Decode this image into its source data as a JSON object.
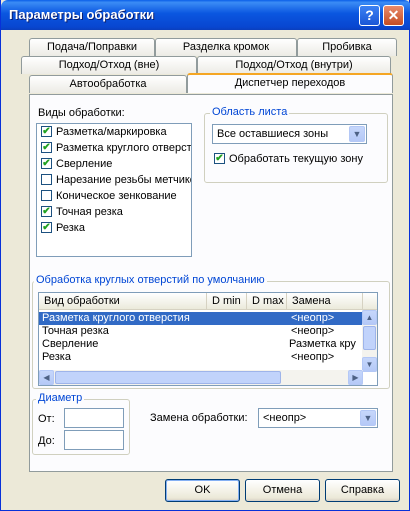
{
  "window": {
    "title": "Параметры обработки"
  },
  "titlebar": {
    "help_icon": "?",
    "close_icon": "✕"
  },
  "tabs": {
    "row1": [
      "Подача/Поправки",
      "Разделка кромок",
      "Пробивка"
    ],
    "row2": [
      "Подход/Отход (вне)",
      "Подход/Отход (внутри)"
    ],
    "row3": [
      "Автообработка",
      "Диспетчер переходов"
    ],
    "active": "Диспетчер переходов"
  },
  "processing_types": {
    "label": "Виды обработки:",
    "items": [
      {
        "label": "Разметка/маркировка",
        "checked": true
      },
      {
        "label": "Разметка круглого отверстия",
        "checked": true
      },
      {
        "label": "Сверление",
        "checked": true
      },
      {
        "label": "Нарезание резьбы метчиком",
        "checked": false
      },
      {
        "label": "Коническое зенкование",
        "checked": false
      },
      {
        "label": "Точная резка",
        "checked": true
      },
      {
        "label": "Резка",
        "checked": true
      }
    ]
  },
  "sheet_area": {
    "title": "Область листа",
    "combo_value": "Все оставшиеся зоны",
    "process_current_label": "Обработать текущую зону",
    "process_current_checked": true
  },
  "round_holes": {
    "title": "Обработка круглых отверстий по умолчанию",
    "columns": [
      "Вид обработки",
      "D min",
      "D max",
      "Замена"
    ],
    "rows": [
      {
        "type": "Разметка круглого отверстия",
        "dmin": "",
        "dmax": "",
        "replace": "<неопр>",
        "selected": true
      },
      {
        "type": "Точная резка",
        "dmin": "",
        "dmax": "",
        "replace": "<неопр>",
        "selected": false
      },
      {
        "type": "Сверление",
        "dmin": "",
        "dmax": "",
        "replace": "Разметка кру",
        "selected": false
      },
      {
        "type": "Резка",
        "dmin": "",
        "dmax": "",
        "replace": "<неопр>",
        "selected": false
      }
    ]
  },
  "diameter": {
    "title": "Диаметр",
    "from_label": "От:",
    "to_label": "До:",
    "from_value": "",
    "to_value": ""
  },
  "replace": {
    "label": "Замена обработки:",
    "value": "<неопр>"
  },
  "buttons": {
    "ok": "OK",
    "cancel": "Отмена",
    "help": "Справка"
  }
}
